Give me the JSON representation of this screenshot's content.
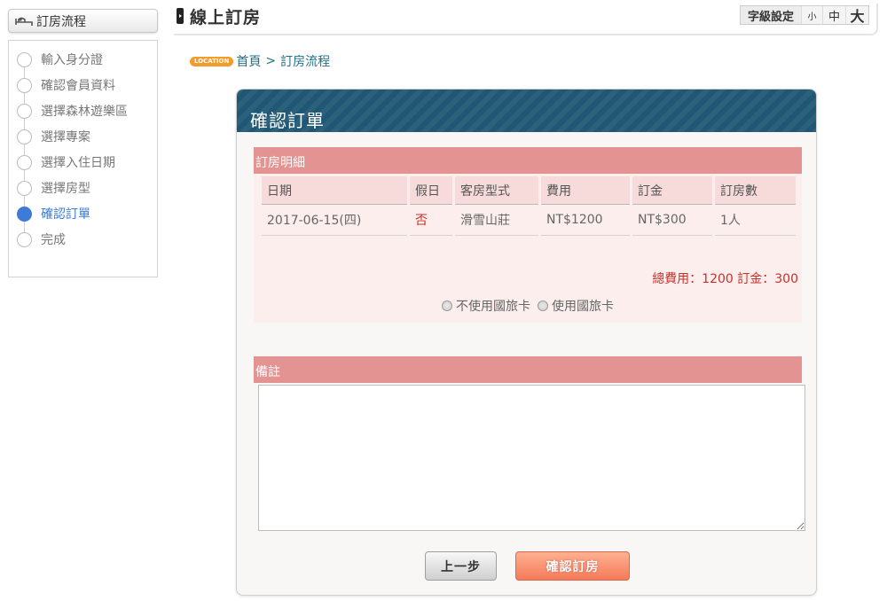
{
  "sidebar": {
    "title": "訂房流程",
    "steps": [
      {
        "label": "輸入身分證"
      },
      {
        "label": "確認會員資料"
      },
      {
        "label": "選擇森林遊樂區"
      },
      {
        "label": "選擇專案"
      },
      {
        "label": "選擇入住日期"
      },
      {
        "label": "選擇房型"
      },
      {
        "label": "確認訂單"
      },
      {
        "label": "完成"
      }
    ],
    "active_step": "確認訂單",
    "active_color": "#3d7bd6"
  },
  "header": {
    "title": "線上訂房",
    "font_setting": {
      "label": "字級設定",
      "small": "小",
      "medium": "中",
      "large": "大"
    }
  },
  "breadcrumb": {
    "badge": "LOCATION",
    "home": "首頁",
    "separator": ">",
    "current": "訂房流程"
  },
  "panel": {
    "title": "確認訂單",
    "detail_section": "訂房明細",
    "table": {
      "headers": [
        "日期",
        "假日",
        "客房型式",
        "費用",
        "訂金",
        "訂房數"
      ],
      "rows": [
        [
          "2017-06-15(四)",
          "否",
          "滑雪山莊",
          "NT$1200",
          "NT$300",
          "1人"
        ]
      ]
    },
    "totals": "總費用：1200 訂金：300",
    "travel_card_options": [
      "不使用國旅卡",
      "使用國旅卡"
    ],
    "remark_section": "備註",
    "remark_value": "",
    "buttons": {
      "back": "上一步",
      "confirm": "確認訂房"
    }
  },
  "colors": {
    "panel_header": "#1f5774",
    "section_bar": "#e39391",
    "alert_text": "#c8312a",
    "confirm_button": "#f47a58"
  }
}
